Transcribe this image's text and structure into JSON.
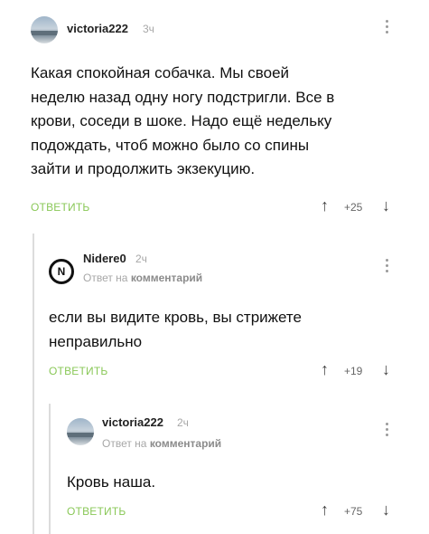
{
  "comments": [
    {
      "author": "victoria222",
      "time": "3ч",
      "lines": [
        "Какая спокойная собачка. Мы своей",
        "неделю назад одну ногу подстригли. Все в",
        "крови, соседи в шоке. Надо ещё недельку",
        "подождать, чтоб можно было со спины",
        "зайти и продолжить экзекуцию."
      ],
      "reply_label": "ОТВЕТИТЬ",
      "score": "+25",
      "up_icon": "arrow-up-icon",
      "down_icon": "arrow-down-icon"
    },
    {
      "author": "Nidere0",
      "avatar_letter": "N",
      "time": "2ч",
      "reply_prefix": "Ответ на",
      "reply_target": "комментарий",
      "lines": [
        "если вы видите кровь, вы стрижете",
        "неправильно"
      ],
      "reply_label": "ОТВЕТИТЬ",
      "score": "+19"
    },
    {
      "author": "victoria222",
      "time": "2ч",
      "reply_prefix": "Ответ на",
      "reply_target": "комментарий",
      "lines": [
        "Кровь наша."
      ],
      "reply_label": "ОТВЕТИТЬ",
      "score": "+75"
    }
  ],
  "icons": {
    "up": "↑",
    "down": "↓"
  }
}
